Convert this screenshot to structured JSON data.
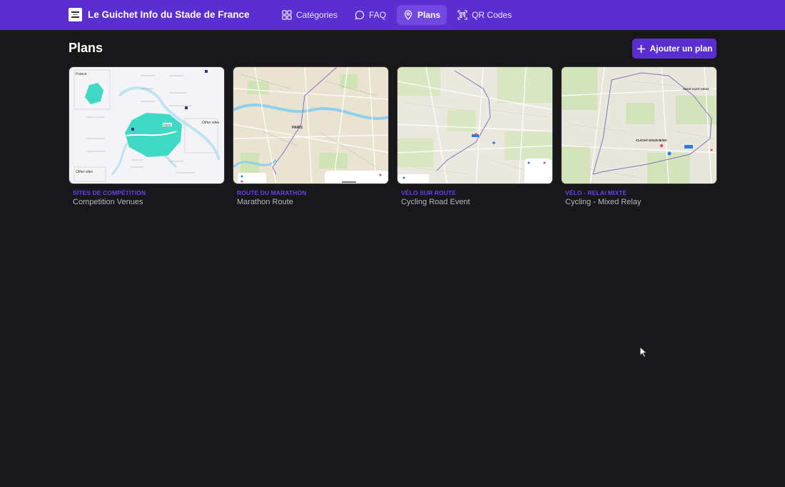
{
  "header": {
    "brand_title": "Le Guichet Info du Stade de France",
    "nav": [
      {
        "label": "Catégories",
        "icon": "grid-icon",
        "active": false
      },
      {
        "label": "FAQ",
        "icon": "chat-bubble-icon",
        "active": false
      },
      {
        "label": "Plans",
        "icon": "map-pin-icon",
        "active": true
      },
      {
        "label": "QR Codes",
        "icon": "qr-code-icon",
        "active": false
      }
    ]
  },
  "main": {
    "title": "Plans",
    "add_button_label": "Ajouter un plan",
    "cards": [
      {
        "category": "Sites de compétition",
        "name": "Competition Venues",
        "map_labels": [
          "France",
          "Paris",
          "Other sites",
          "Other sites"
        ]
      },
      {
        "category": "Route du marathon",
        "name": "Marathon Route",
        "map_labels": [
          "PARIS"
        ]
      },
      {
        "category": "Vélo sur route",
        "name": "Cycling Road Event",
        "map_labels": []
      },
      {
        "category": "Vélo - Relai mixte",
        "name": "Cycling - Mixed Relay",
        "map_labels": [
          "CLICHY-SOUS-BOIS",
          "SEINE-SAINT-DENIS"
        ]
      }
    ]
  },
  "colors": {
    "brand": "#5b2ed1",
    "brand_active": "#7348e0",
    "category_text": "#6d3ef0",
    "background": "#18171a"
  }
}
